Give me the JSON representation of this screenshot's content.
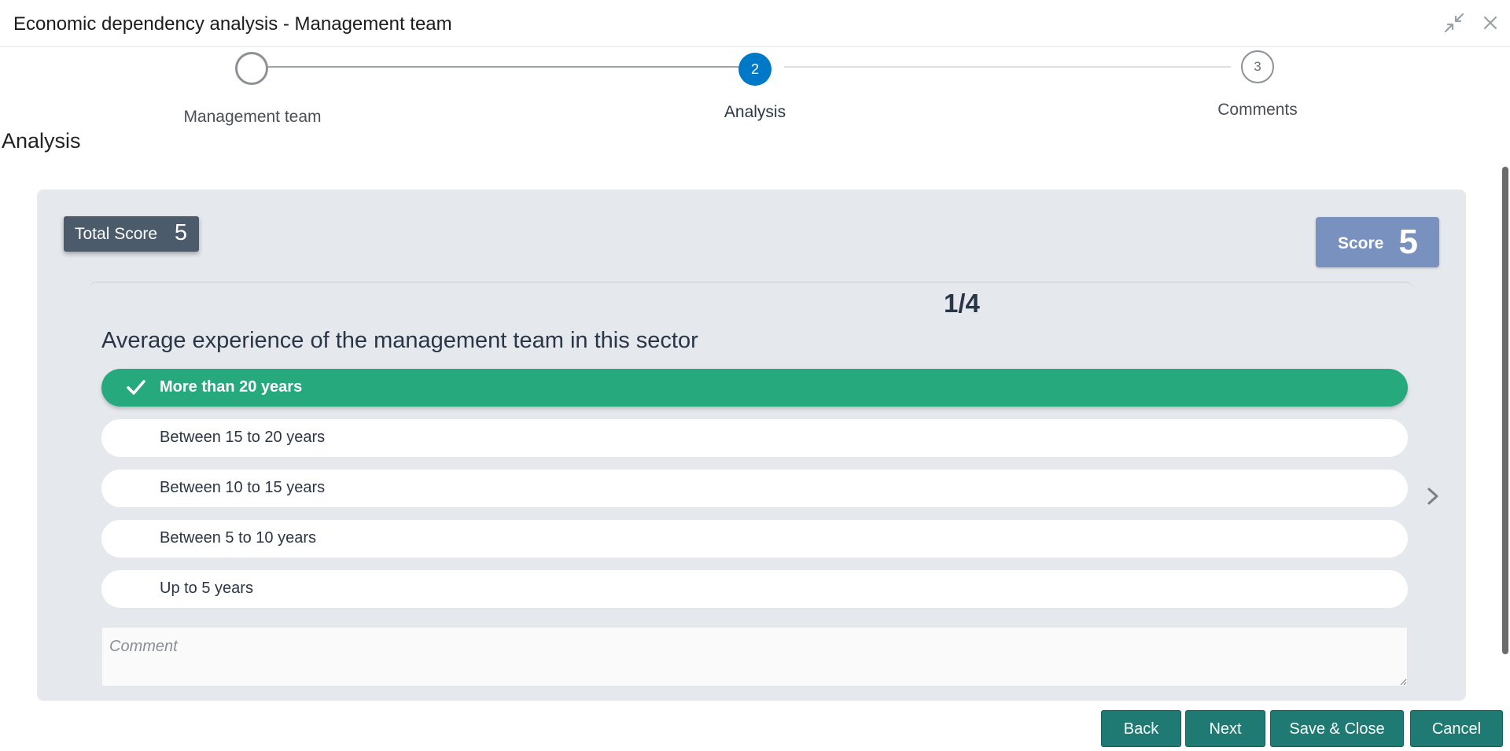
{
  "window": {
    "title": "Economic dependency analysis - Management team"
  },
  "stepper": {
    "steps": [
      {
        "number": "",
        "label": "Management team",
        "state": "completed"
      },
      {
        "number": "2",
        "label": "Analysis",
        "state": "active"
      },
      {
        "number": "3",
        "label": "Comments",
        "state": "pending"
      }
    ]
  },
  "section": {
    "title": "Analysis"
  },
  "scores": {
    "total_label": "Total Score",
    "total_value": "5",
    "question_label": "Score",
    "question_value": "5"
  },
  "question": {
    "pager": "1/4",
    "text": "Average experience of the management team in this sector",
    "options": [
      {
        "label": "More than 20 years",
        "selected": true
      },
      {
        "label": "Between 15 to 20 years",
        "selected": false
      },
      {
        "label": "Between 10 to 15 years",
        "selected": false
      },
      {
        "label": "Between 5 to 10 years",
        "selected": false
      },
      {
        "label": "Up to 5 years",
        "selected": false
      }
    ],
    "comment_placeholder": "Comment"
  },
  "footer": {
    "back": "Back",
    "next": "Next",
    "save_close": "Save & Close",
    "cancel": "Cancel"
  },
  "colors": {
    "accent": "#0078c8",
    "selected_option": "#27a97e",
    "button": "#1e7a73",
    "score_box": "#7891be",
    "total_score_box": "#4b5b6b"
  },
  "icons": {
    "minimize": "collapse-arrows-icon",
    "close": "close-icon",
    "check": "check-icon",
    "next": "chevron-right-icon"
  }
}
